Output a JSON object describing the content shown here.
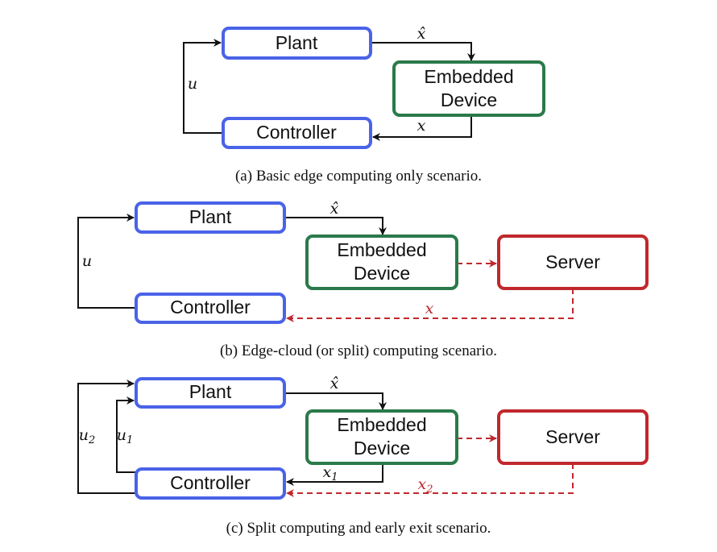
{
  "labels": {
    "plant": "Plant",
    "embedded_line1": "Embedded",
    "embedded_line2": "Device",
    "controller": "Controller",
    "server": "Server"
  },
  "signals": {
    "x_hat": "x̂",
    "x": "x",
    "u": "u",
    "x1": "x",
    "x1_sub": "1",
    "x2": "x",
    "x2_sub": "2",
    "u1": "u",
    "u1_sub": "1",
    "u2": "u",
    "u2_sub": "2"
  },
  "captions": {
    "a": "(a) Basic edge computing only scenario.",
    "b": "(b) Edge-cloud (or split) computing scenario.",
    "c": "(c) Split computing and early exit scenario."
  },
  "colors": {
    "device_blue": "#4a63e8",
    "embedded_green": "#2a7a4a",
    "server_red": "#c0282d"
  }
}
